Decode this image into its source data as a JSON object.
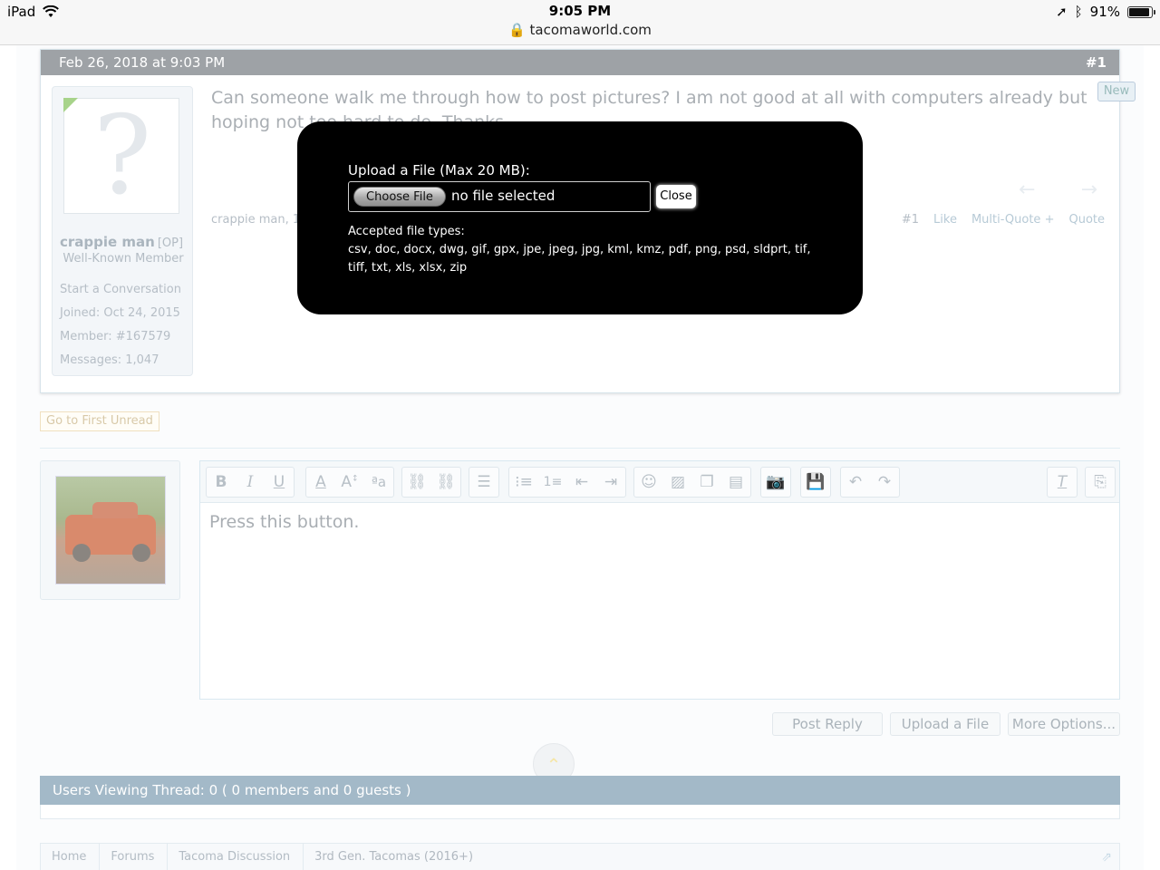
{
  "status": {
    "device": "iPad",
    "time": "9:05 PM",
    "url": "tacomaworld.com",
    "battery": "91%"
  },
  "post": {
    "date": "Feb 26, 2018 at 9:03 PM",
    "number": "#1",
    "new_badge": "New",
    "body": "Can someone walk me through how to post pictures? I am not good at all with computers already but hoping not too hard to do. Thanks",
    "meta": "crappie man, 1",
    "actions": {
      "num": "#1",
      "like": "Like",
      "multiquote": "Multi-Quote +",
      "quote": "Quote"
    }
  },
  "user": {
    "name": "crappie man",
    "op": "[OP]",
    "title": "Well-Known Member",
    "start_conversation": "Start a Conversation",
    "joined": "Joined:  Oct 24, 2015",
    "member": "Member:  #167579",
    "messages": "Messages:  1,047"
  },
  "go_first_unread": "Go to First Unread",
  "editor": {
    "text": "Press this button.",
    "toolbar_icons": [
      "bold-icon",
      "italic-icon",
      "underline-icon",
      "font-color-icon",
      "font-size-icon",
      "font-family-icon",
      "link-icon",
      "unlink-icon",
      "align-icon",
      "bullet-list-icon",
      "numbered-list-icon",
      "outdent-icon",
      "indent-icon",
      "smilie-icon",
      "image-icon",
      "media-icon",
      "code-icon",
      "camera-icon",
      "save-draft-icon",
      "undo-icon",
      "redo-icon",
      "remove-format-icon",
      "toggle-bbcode-icon"
    ]
  },
  "buttons": {
    "post_reply": "Post Reply",
    "upload_file": "Upload a File",
    "more_options": "More Options..."
  },
  "users_viewing": "Users Viewing Thread: 0 ( 0 members and 0 guests )",
  "breadcrumb": [
    "Home",
    "Forums",
    "Tacoma Discussion",
    "3rd Gen. Tacomas (2016+)"
  ],
  "modal": {
    "title": "Upload a File (Max 20 MB):",
    "choose_file": "Choose File",
    "no_file": "no file selected",
    "close": "Close",
    "accepted_label": "Accepted file types:",
    "accepted_types": "csv, doc, docx, dwg, gif, gpx, jpe, jpeg, jpg, kml, kmz, pdf, png, psd, sldprt, tif, tiff, txt, xls, xlsx, zip"
  }
}
